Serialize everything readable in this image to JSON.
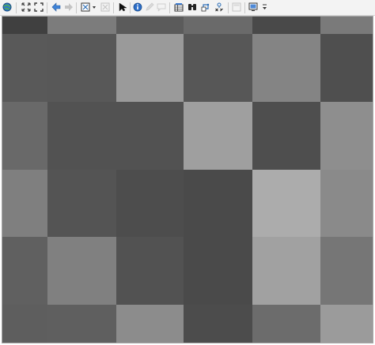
{
  "toolbar": {
    "tools": [
      {
        "name": "globe-icon",
        "enabled": true
      },
      {
        "name": "full-extent-icon",
        "enabled": true
      },
      {
        "name": "zoom-extent-icon",
        "enabled": true
      },
      {
        "name": "back-arrow-icon",
        "enabled": true
      },
      {
        "name": "forward-arrow-icon",
        "enabled": false
      },
      {
        "name": "layer-select-icon",
        "enabled": true
      },
      {
        "name": "dropdown-arrow-icon",
        "enabled": true
      },
      {
        "name": "clear-selection-icon",
        "enabled": false
      },
      {
        "name": "pointer-icon",
        "enabled": true
      },
      {
        "name": "info-icon",
        "enabled": true
      },
      {
        "name": "edit-pencil-icon",
        "enabled": false
      },
      {
        "name": "comment-icon",
        "enabled": false
      },
      {
        "name": "table-icon",
        "enabled": true
      },
      {
        "name": "binoculars-icon",
        "enabled": true
      },
      {
        "name": "route-icon",
        "enabled": true
      },
      {
        "name": "xy-icon",
        "enabled": true
      },
      {
        "name": "window-icon",
        "enabled": false
      },
      {
        "name": "screen-icon",
        "enabled": true
      },
      {
        "name": "overflow-icon",
        "enabled": true
      }
    ]
  },
  "raster": {
    "rows": 6,
    "cols": 6,
    "colors": [
      [
        "#404040",
        "#7c7c7c",
        "#5b5b5b",
        "#6a6a6a",
        "#494949",
        "#7a7a7a"
      ],
      [
        "#595959",
        "#585858",
        "#9a9a9a",
        "#575757",
        "#848484",
        "#4f4f4f"
      ],
      [
        "#696969",
        "#525252",
        "#525252",
        "#9f9f9f",
        "#4e4e4e",
        "#8e8e8e"
      ],
      [
        "#7f7f7f",
        "#545454",
        "#4d4d4d",
        "#4a4a4a",
        "#acacac",
        "#8a8a8a"
      ],
      [
        "#606060",
        "#808080",
        "#525252",
        "#4a4a4a",
        "#a1a1a1",
        "#767676"
      ],
      [
        "#5e5e5e",
        "#5f5f5f",
        "#8c8c8c",
        "#4c4c4c",
        "#6c6c6c",
        "#9b9b9b"
      ]
    ]
  }
}
